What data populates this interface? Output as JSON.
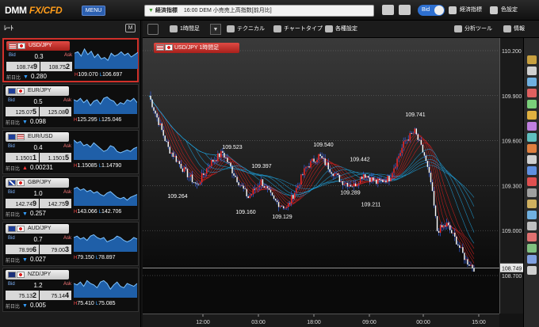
{
  "app": {
    "logo_main": "DMM",
    "logo_fx": "FX/CFD",
    "menu_label": "MENU",
    "news_tag": "経済指標",
    "news_text": "16:00 DEM 小売売上高指数[前月比]",
    "bid_label": "Bid",
    "indicator_label": "経済指標",
    "color_label": "色設定"
  },
  "left_panel": {
    "brand": "ﾚｰﾄ",
    "m_button": "M",
    "bid_label": "Bid",
    "ask_label": "Ask",
    "prev_label": "前日比",
    "pairs": [
      {
        "name": "USD/JPY",
        "flag_a": "us",
        "flag_b": "jp",
        "spread": "0.3",
        "bid_main": "108.74",
        "bid_last": "9",
        "ask_main": "108.75",
        "ask_last": "2",
        "change": "0.280",
        "direction": "down",
        "high": "109.070",
        "low": "106.697",
        "active": true,
        "spark": [
          0.55,
          0.6,
          0.45,
          0.7,
          0.5,
          0.62,
          0.4,
          0.52,
          0.35,
          0.4,
          0.3,
          0.55,
          0.45,
          0.5,
          0.6,
          0.48,
          0.55,
          0.42,
          0.5,
          0.58
        ]
      },
      {
        "name": "EUR/JPY",
        "flag_a": "eu",
        "flag_b": "jp",
        "spread": "0.5",
        "bid_main": "125.07",
        "bid_last": "5",
        "ask_main": "125.08",
        "ask_last": "0",
        "change": "0.098",
        "direction": "down",
        "high": "125.295",
        "low": "125.046",
        "active": false,
        "spark": [
          0.5,
          0.45,
          0.55,
          0.4,
          0.5,
          0.3,
          0.45,
          0.5,
          0.35,
          0.55,
          0.6,
          0.5,
          0.45,
          0.3,
          0.4,
          0.35,
          0.5,
          0.45,
          0.55,
          0.4
        ]
      },
      {
        "name": "EUR/USD",
        "flag_a": "eu",
        "flag_b": "us",
        "spread": "0.4",
        "bid_main": "1.1501",
        "bid_last": "1",
        "ask_main": "1.1501",
        "ask_last": "5",
        "change": "0.00231",
        "direction": "up",
        "high": "1.15085",
        "low": "1.14790",
        "active": false,
        "spark": [
          0.7,
          0.6,
          0.65,
          0.5,
          0.55,
          0.45,
          0.6,
          0.5,
          0.4,
          0.3,
          0.35,
          0.5,
          0.45,
          0.3,
          0.25,
          0.3,
          0.35,
          0.3,
          0.4,
          0.45
        ]
      },
      {
        "name": "GBP/JPY",
        "flag_a": "uk",
        "flag_b": "jp",
        "spread": "1.0",
        "bid_main": "142.74",
        "bid_last": "9",
        "ask_main": "142.75",
        "ask_last": "9",
        "change": "0.257",
        "direction": "down",
        "high": "143.066",
        "low": "142.706",
        "active": false,
        "spark": [
          0.6,
          0.65,
          0.55,
          0.6,
          0.5,
          0.55,
          0.45,
          0.5,
          0.4,
          0.35,
          0.45,
          0.5,
          0.4,
          0.3,
          0.25,
          0.3,
          0.2,
          0.3,
          0.35,
          0.4
        ]
      },
      {
        "name": "AUD/JPY",
        "flag_a": "au",
        "flag_b": "jp",
        "spread": "0.7",
        "bid_main": "78.99",
        "bid_last": "6",
        "ask_main": "79.00",
        "ask_last": "3",
        "change": "0.027",
        "direction": "down",
        "high": "79.150",
        "low": "78.897",
        "active": false,
        "spark": [
          0.5,
          0.55,
          0.45,
          0.5,
          0.4,
          0.55,
          0.6,
          0.5,
          0.45,
          0.5,
          0.35,
          0.4,
          0.45,
          0.55,
          0.5,
          0.4,
          0.35,
          0.4,
          0.5,
          0.45
        ]
      },
      {
        "name": "NZD/JPY",
        "flag_a": "nz",
        "flag_b": "jp",
        "spread": "1.2",
        "bid_main": "75.13",
        "bid_last": "2",
        "ask_main": "75.14",
        "ask_last": "4",
        "change": "0.005",
        "direction": "down",
        "high": "75.410",
        "low": "75.085",
        "active": false,
        "spark": [
          0.5,
          0.45,
          0.55,
          0.4,
          0.6,
          0.5,
          0.45,
          0.35,
          0.55,
          0.6,
          0.5,
          0.3,
          0.45,
          0.55,
          0.4,
          0.35,
          0.5,
          0.45,
          0.4,
          0.5
        ]
      }
    ]
  },
  "toolbar": {
    "timeframe": "1時間足",
    "dropdown_arrow": "▼",
    "technical": "テクニカル",
    "chart_type": "チャートタイプ",
    "settings": "各種設定",
    "analysis_tool": "分析ツール",
    "info": "情報"
  },
  "chart": {
    "title": "USD/JPY 1時間足",
    "current_price": "108.749",
    "y_ticks": [
      "110.200",
      "109.900",
      "109.600",
      "109.300",
      "109.000",
      "108.700"
    ],
    "x_ticks": [
      "12:00",
      "03:00",
      "18:00",
      "09:00",
      "00:00",
      "15:00"
    ],
    "annotations": [
      {
        "label": "109.264",
        "value": 109.264,
        "kind": "low"
      },
      {
        "label": "109.523",
        "value": 109.523,
        "kind": "high"
      },
      {
        "label": "109.397",
        "value": 109.397,
        "kind": "high"
      },
      {
        "label": "109.160",
        "value": 109.16,
        "kind": "low"
      },
      {
        "label": "109.129",
        "value": 109.129,
        "kind": "low"
      },
      {
        "label": "109.540",
        "value": 109.54,
        "kind": "high"
      },
      {
        "label": "109.442",
        "value": 109.442,
        "kind": "high"
      },
      {
        "label": "109.289",
        "value": 109.289,
        "kind": "low"
      },
      {
        "label": "109.211",
        "value": 109.211,
        "kind": "low"
      },
      {
        "label": "109.741",
        "value": 109.741,
        "kind": "high"
      }
    ],
    "colors": {
      "up": "#ff2a2a",
      "down": "#ffffff",
      "wick": "#3a6bff",
      "ma_fast": "#d42020",
      "ma_slow": "#1e9fd8"
    }
  }
}
